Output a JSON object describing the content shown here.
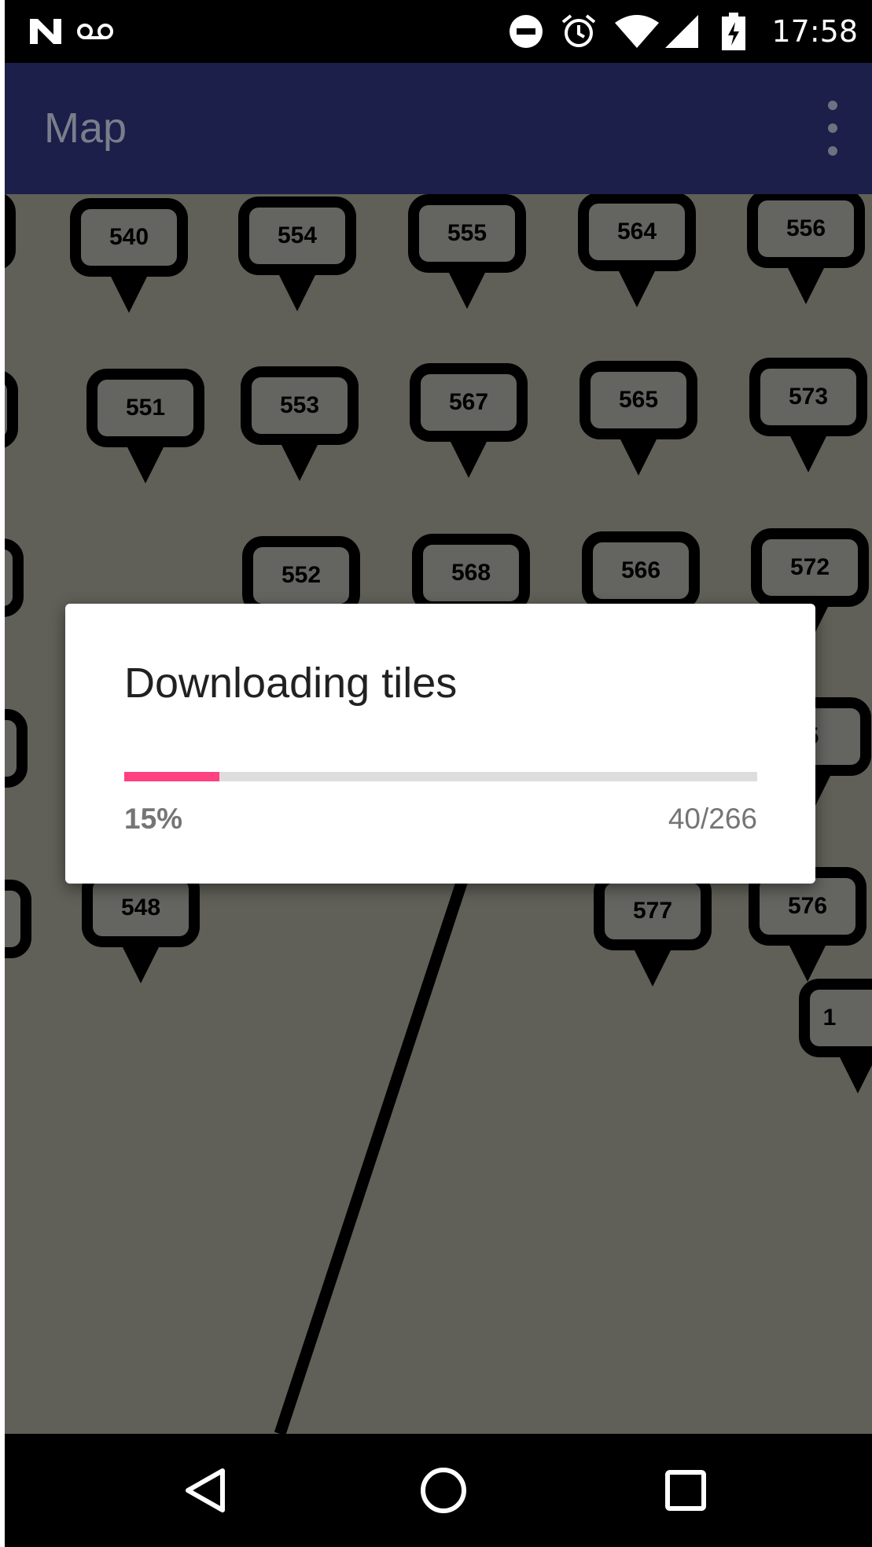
{
  "status_bar": {
    "time": "17:58",
    "icons": [
      "n-logo-icon",
      "voicemail-icon",
      "do-not-disturb-icon",
      "alarm-icon",
      "wifi-icon",
      "signal-icon",
      "battery-charging-icon"
    ]
  },
  "app_bar": {
    "title": "Map",
    "menu_icon": "overflow-menu-icon"
  },
  "map": {
    "markers": [
      "540",
      "554",
      "555",
      "564",
      "556",
      "551",
      "553",
      "567",
      "565",
      "573",
      "552",
      "568",
      "566",
      "572",
      "5",
      "548",
      "577",
      "576",
      "1"
    ]
  },
  "dialog": {
    "title": "Downloading tiles",
    "progress_fraction": 0.15,
    "progress_percent": "15%",
    "progress_count": "40/266",
    "accent_color": "#ff4081"
  },
  "nav_bar": {
    "icons": [
      "back-icon",
      "home-icon",
      "recents-icon"
    ]
  }
}
